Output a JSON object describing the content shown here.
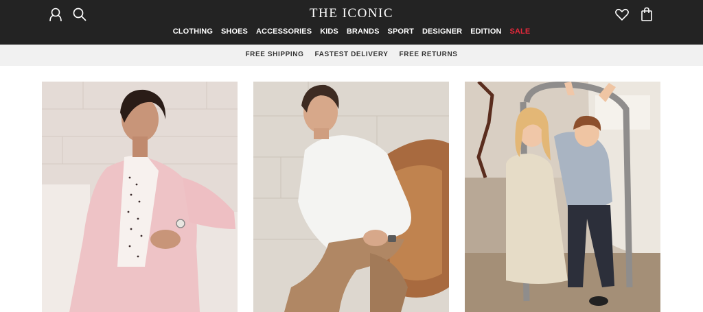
{
  "brand": {
    "logo_text": "THE ICONIC"
  },
  "header_icons": {
    "account": "account-icon",
    "search": "search-icon",
    "wishlist": "heart-icon",
    "bag": "shopping-bag-icon"
  },
  "nav": {
    "items": [
      {
        "label": "CLOTHING"
      },
      {
        "label": "SHOES"
      },
      {
        "label": "ACCESSORIES"
      },
      {
        "label": "KIDS"
      },
      {
        "label": "BRANDS"
      },
      {
        "label": "SPORT"
      },
      {
        "label": "DESIGNER"
      },
      {
        "label": "EDITION"
      },
      {
        "label": "SALE"
      }
    ]
  },
  "promo": {
    "items": [
      {
        "label": "FREE SHIPPING"
      },
      {
        "label": "FASTEST DELIVERY"
      },
      {
        "label": "FREE RETURNS"
      }
    ]
  },
  "tiles": [
    {
      "name": "women-tile"
    },
    {
      "name": "men-tile"
    },
    {
      "name": "kids-tile"
    }
  ],
  "colors": {
    "header_bg": "#232323",
    "promo_bg": "#f1f1f1",
    "sale": "#e8283b"
  }
}
